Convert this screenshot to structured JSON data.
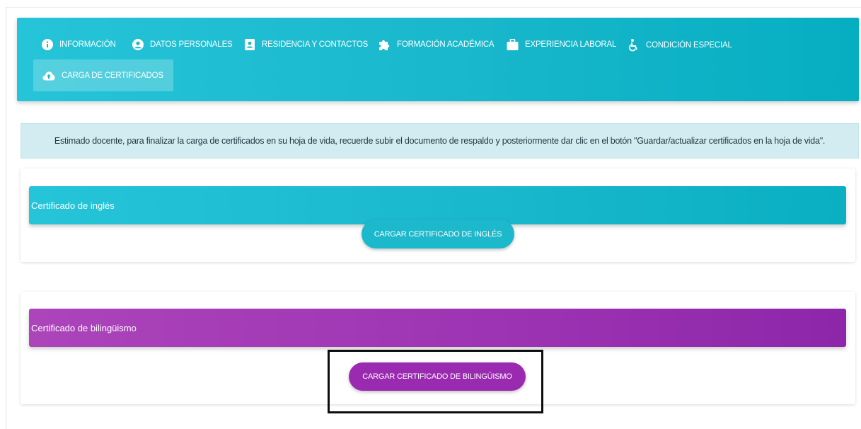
{
  "nav": {
    "items": [
      {
        "label": "INFORMACIÓN",
        "icon": "info-circle-icon"
      },
      {
        "label": "DATOS PERSONALES",
        "icon": "user-circle-icon"
      },
      {
        "label": "RESIDENCIA Y CONTACTOS",
        "icon": "address-book-icon"
      },
      {
        "label": "FORMACIÓN ACADÉMICA",
        "icon": "puzzle-icon"
      },
      {
        "label": "EXPERIENCIA LABORAL",
        "icon": "briefcase-icon"
      },
      {
        "label": "CONDICIÓN ESPECIAL",
        "icon": "wheelchair-icon"
      },
      {
        "label": "CARGA DE CERTIFICADOS",
        "icon": "cloud-upload-icon",
        "active": true
      }
    ]
  },
  "alert": {
    "text": "Estimado docente, para finalizar la carga de certificados en su hoja de vida, recuerde subir el documento de respaldo y posteriormente dar clic en el botón \"Guardar/actualizar certificados en la hoja de vida\"."
  },
  "cards": {
    "english": {
      "title": "Certificado de inglés",
      "button_label": "CARGAR CERTIFICADO DE INGLÉS"
    },
    "bilingual": {
      "title": "Certificado de bilingüismo",
      "button_label": "CARGAR CERTIFICADO DE BILINGÜISMO"
    }
  },
  "colors": {
    "primary_cyan": "#1ab8cc",
    "accent_purple": "#9c33b3",
    "alert_bg": "#d2ecf1"
  }
}
